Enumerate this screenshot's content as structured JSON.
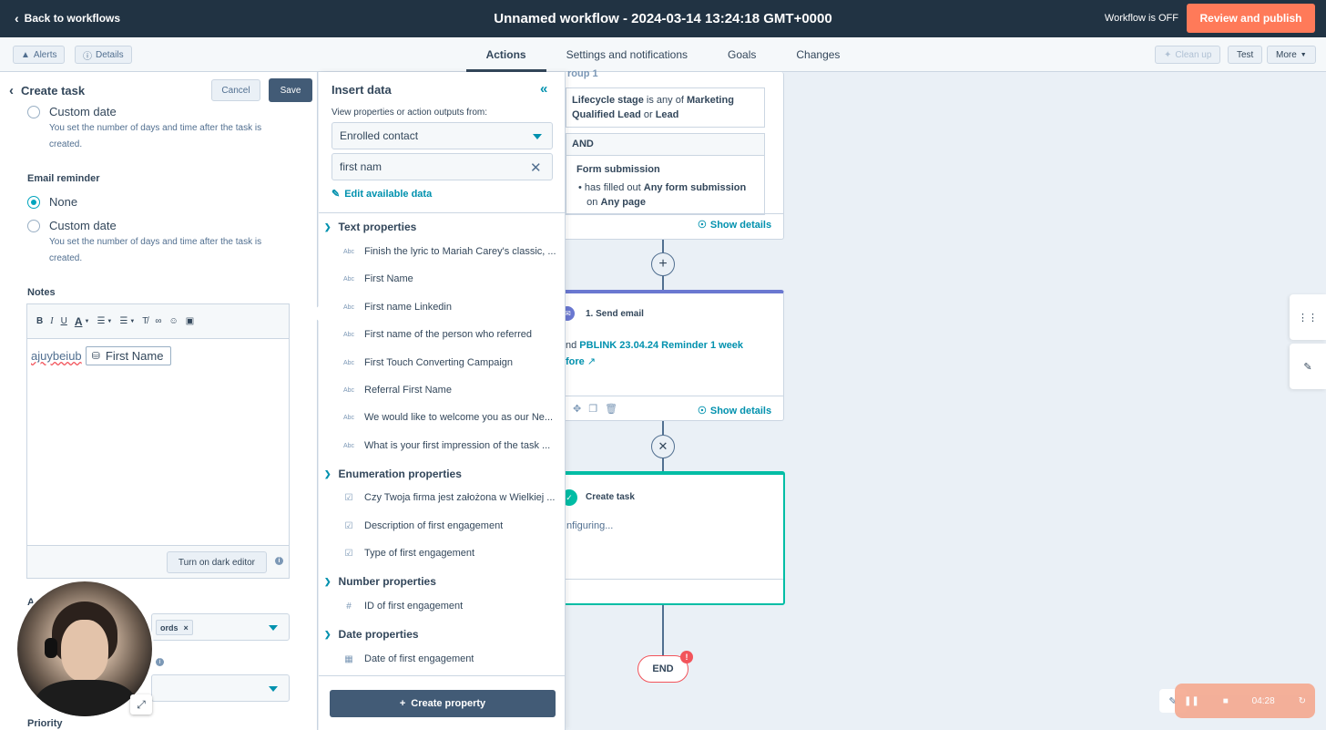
{
  "topbar": {
    "back_label": "Back to workflows",
    "title": "Unnamed workflow - 2024-03-14 13:24:18 GMT+0000",
    "status": "Workflow is OFF",
    "review_label": "Review and publish"
  },
  "subbar": {
    "alerts_label": "Alerts",
    "details_label": "Details",
    "tabs": [
      "Actions",
      "Settings and notifications",
      "Goals",
      "Changes"
    ],
    "cleanup_label": "Clean up",
    "test_label": "Test",
    "more_label": "More"
  },
  "left_panel": {
    "title": "Create task",
    "cancel_label": "Cancel",
    "save_label": "Save",
    "due_custom_label": "Custom date",
    "due_custom_help": "You set the number of days and time after the task is created.",
    "email_reminder_label": "Email reminder",
    "reminder_none_label": "None",
    "reminder_custom_label": "Custom date",
    "reminder_custom_help": "You set the number of days and time after the task is created.",
    "notes_label": "Notes",
    "notes_typed": "ajuybeiub",
    "notes_token": "First Name",
    "dark_editor_label": "Turn on dark editor",
    "assoc_label_fragment": "A",
    "tag_chip": "ords",
    "priority_label": "Priority"
  },
  "insert_data": {
    "title": "Insert data",
    "sub": "View properties or action outputs from:",
    "source": "Enrolled contact",
    "search_value": "first nam",
    "edit_label": "Edit available data",
    "groups": [
      {
        "name": "Text properties",
        "items": [
          "Finish the lyric to Mariah Carey's classic, ...",
          "First Name",
          "First name Linkedin",
          "First name of the person who referred",
          "First Touch Converting Campaign",
          "Referral First Name",
          "We would like to welcome you as our Ne...",
          "What is your first impression of the task ..."
        ]
      },
      {
        "name": "Enumeration properties",
        "items": [
          "Czy Twoja firma jest założona w Wielkiej ...",
          "Description of first engagement",
          "Type of first engagement"
        ]
      },
      {
        "name": "Number properties",
        "items": [
          "ID of first engagement"
        ]
      },
      {
        "name": "Date properties",
        "items": [
          "Date of first engagement"
        ]
      }
    ],
    "create_property_label": "Create property"
  },
  "canvas": {
    "group_header_fragment": "roup 1",
    "filter1_a": "Lifecycle stage",
    "filter1_b": " is any of ",
    "filter1_c": "Marketing Qualified Lead",
    "filter1_d": " or ",
    "filter1_e": "Lead",
    "and_label": "AND",
    "form_title": "Form submission",
    "form_line_a": "has filled out ",
    "form_line_b": "Any form submission",
    "form_line_c": "on ",
    "form_line_d": "Any page",
    "show_details_1": "Show details",
    "action1_title": "1. Send email",
    "action1_body_pre": "nd ",
    "action1_link_1": "PBLINK 23.04.24 Reminder 1 week",
    "action1_link_2": "fore",
    "show_details_2": "Show details",
    "action2_title": "Create task",
    "action2_status": "nfiguring...",
    "end_label": "END",
    "end_badge": "!"
  },
  "recorder": {
    "time": "04:28"
  }
}
